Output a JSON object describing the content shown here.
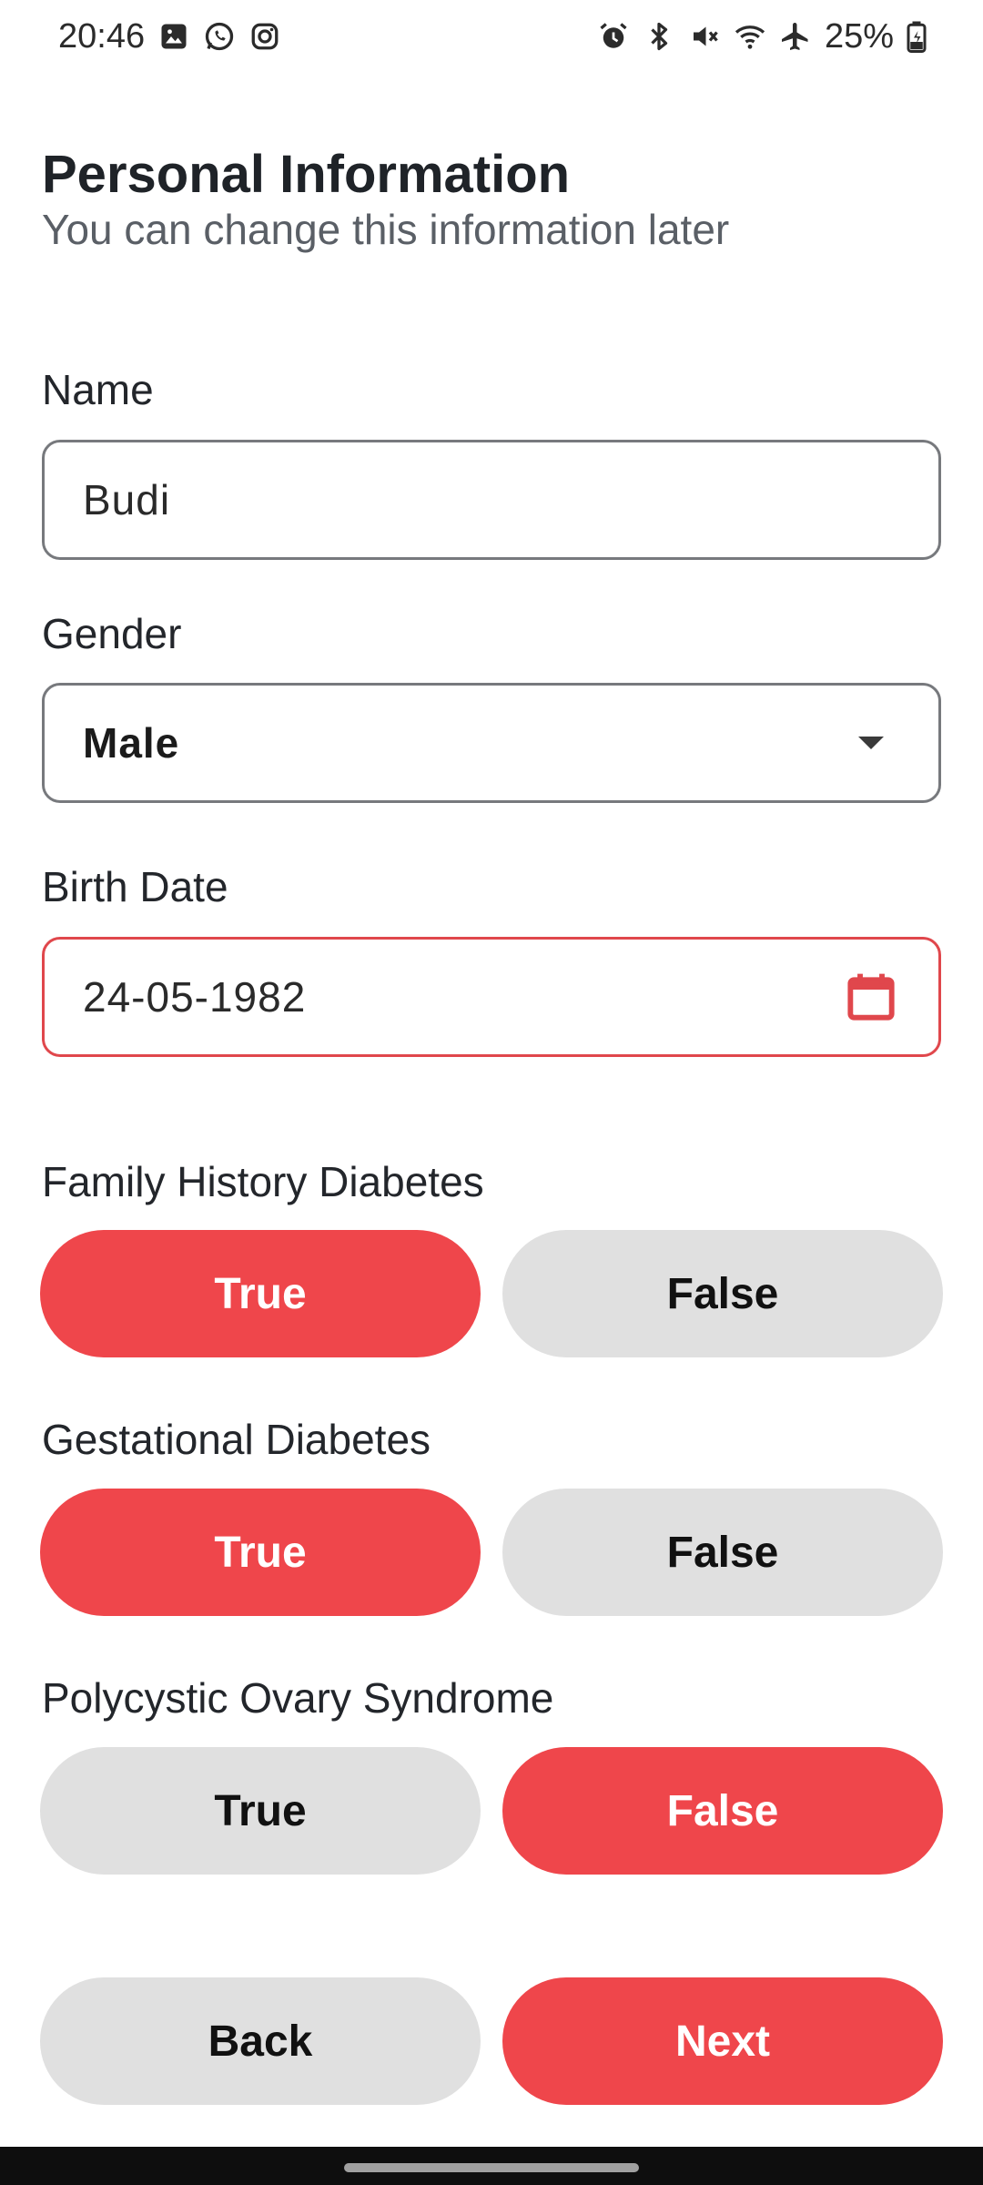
{
  "status_bar": {
    "time": "20:46",
    "left_icons": [
      "gallery-icon",
      "whatsapp-icon",
      "instagram-icon"
    ],
    "right_icons": [
      "alarm-icon",
      "bluetooth-icon",
      "mute-icon",
      "wifi-icon",
      "airplane-icon"
    ],
    "battery": "25%"
  },
  "header": {
    "title": "Personal Information",
    "subtitle": "You can change this information later"
  },
  "form": {
    "name": {
      "label": "Name",
      "value": "Budi"
    },
    "gender": {
      "label": "Gender",
      "value": "Male"
    },
    "birth_date": {
      "label": "Birth Date",
      "value": "24-05-1982"
    },
    "family_history": {
      "label": "Family History Diabetes",
      "true_label": "True",
      "false_label": "False",
      "selected": "True"
    },
    "gestational": {
      "label": "Gestational Diabetes",
      "true_label": "True",
      "false_label": "False",
      "selected": "True"
    },
    "pcos": {
      "label": "Polycystic Ovary Syndrome",
      "true_label": "True",
      "false_label": "False",
      "selected": "False"
    }
  },
  "actions": {
    "back_label": "Back",
    "next_label": "Next"
  },
  "colors": {
    "accent": "#ef464b",
    "inactive": "#e0e0e0",
    "error_border": "#e0474c"
  }
}
